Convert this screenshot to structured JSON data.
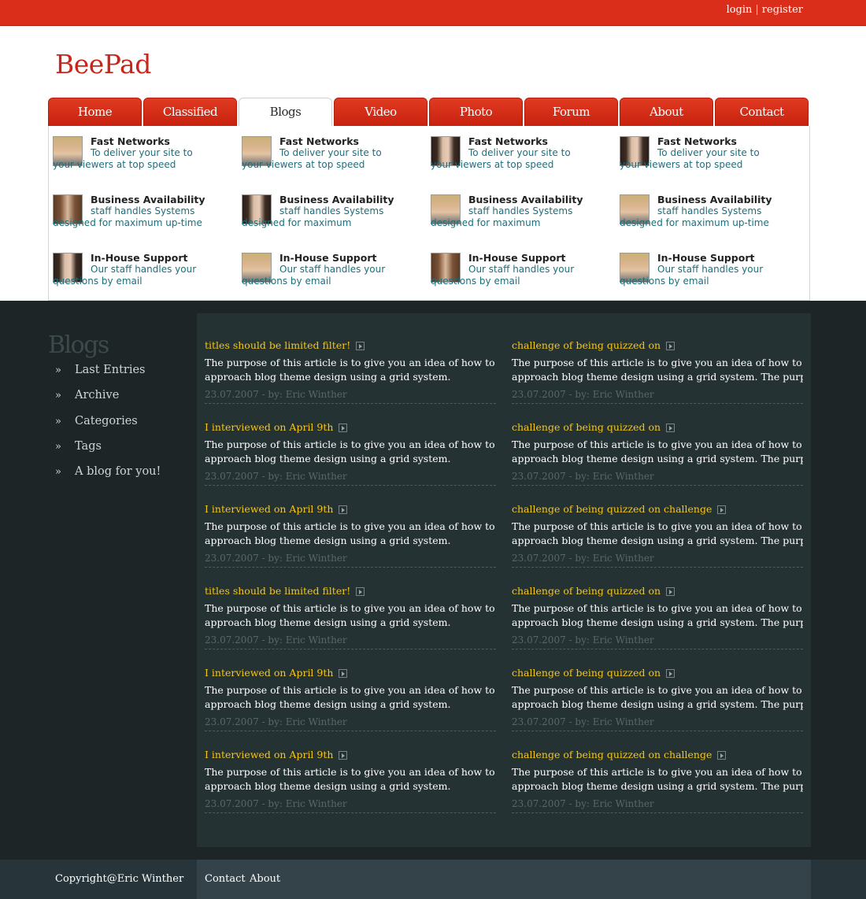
{
  "topbar": {
    "login": "login",
    "separator": "|",
    "register": "register"
  },
  "logo": "BeePad",
  "nav": [
    "Home",
    "Classified",
    "Blogs",
    "Video",
    "Photo",
    "Forum",
    "About",
    "Contact"
  ],
  "nav_active": "Blogs",
  "features": [
    {
      "title": "Fast Networks",
      "desc": "To deliver your site to your viewers at top speed",
      "avatar": "male-blond-avatar"
    },
    {
      "title": "Fast Networks",
      "desc": "To deliver your site to your viewers at top speed",
      "avatar": "male-blond-avatar"
    },
    {
      "title": "Fast Networks",
      "desc": "To deliver your site to your viewers at top speed",
      "avatar": "female-dark-hair-avatar"
    },
    {
      "title": "Fast Networks",
      "desc": "To deliver your site to your viewers at top speed",
      "avatar": "female-dark-hair-avatar"
    },
    {
      "title": "Business Availability",
      "desc": "staff handles Systems designed for maximum up-time",
      "avatar": "female-brown-hair-avatar"
    },
    {
      "title": "Business Availability",
      "desc": "staff handles Systems designed for maximum",
      "avatar": "female-dark-hair-avatar"
    },
    {
      "title": "Business Availability",
      "desc": "staff handles Systems designed for maximum",
      "avatar": "male-blond-avatar"
    },
    {
      "title": "Business Availability",
      "desc": "staff handles Systems designed for maximum up-time",
      "avatar": "male-blond-avatar"
    },
    {
      "title": "In-House Support",
      "desc": "Our staff handles your questions by email",
      "avatar": "female-dark-hair-avatar"
    },
    {
      "title": "In-House Support",
      "desc": "Our staff handles your questions by email",
      "avatar": "male-blond-avatar"
    },
    {
      "title": "In-House Support",
      "desc": "Our staff handles your questions by email",
      "avatar": "female-brown-hair-avatar"
    },
    {
      "title": "In-House Support",
      "desc": "Our staff handles your questions by email",
      "avatar": "male-blond-avatar"
    }
  ],
  "sidebar": {
    "title": "Blogs",
    "bullet": "»",
    "items": [
      "Last Entries",
      "Archive",
      "Categories",
      "Tags",
      "A blog for you!"
    ]
  },
  "posts": [
    {
      "title": "titles should be limited filter!",
      "line1": "The purpose of this article is to give you an idea of how to",
      "line2": "approach blog theme design using a grid system.",
      "meta": "23.07.2007 - by: Eric Winther"
    },
    {
      "title": "challenge of being quizzed on",
      "line1": "The purpose of this article is to give you an idea of how to",
      "line2": "approach blog theme design using a grid system. The purpose of",
      "meta": "23.07.2007 - by: Eric Winther"
    },
    {
      "title": "I interviewed on April 9th",
      "line1": "The purpose of this article is to give you an idea of how to",
      "line2": "approach blog theme design using a grid system.",
      "meta": "23.07.2007 - by: Eric Winther"
    },
    {
      "title": "challenge of being quizzed on",
      "line1": "The purpose of this article is to give you an idea of how to",
      "line2": "approach blog theme design using a grid system. The purpose of",
      "meta": "23.07.2007 - by: Eric Winther"
    },
    {
      "title": "I interviewed on April 9th",
      "line1": "The purpose of this article is to give you an idea of how to",
      "line2": "approach blog theme design using a grid system.",
      "meta": "23.07.2007 - by: Eric Winther"
    },
    {
      "title": "challenge of being quizzed on challenge",
      "line1": "The purpose of this article is to give you an idea of how to",
      "line2": "approach blog theme design using a grid system. The purpose of",
      "meta": "23.07.2007 - by: Eric Winther"
    },
    {
      "title": "titles should be limited filter!",
      "line1": "The purpose of this article is to give you an idea of how to",
      "line2": "approach blog theme design using a grid system.",
      "meta": "23.07.2007 - by: Eric Winther"
    },
    {
      "title": "challenge of being quizzed on",
      "line1": "The purpose of this article is to give you an idea of how to",
      "line2": "approach blog theme design using a grid system. The purpose of",
      "meta": "23.07.2007 - by: Eric Winther"
    },
    {
      "title": "I interviewed on April 9th",
      "line1": "The purpose of this article is to give you an idea of how to",
      "line2": "approach blog theme design using a grid system.",
      "meta": "23.07.2007 - by: Eric Winther"
    },
    {
      "title": "challenge of being quizzed on",
      "line1": "The purpose of this article is to give you an idea of how to",
      "line2": "approach blog theme design using a grid system. The purpose of",
      "meta": "23.07.2007 - by: Eric Winther"
    },
    {
      "title": "I interviewed on April 9th",
      "line1": "The purpose of this article is to give you an idea of how to",
      "line2": "approach blog theme design using a grid system.",
      "meta": "23.07.2007 - by: Eric Winther"
    },
    {
      "title": "challenge of being quizzed on challenge",
      "line1": "The purpose of this article is to give you an idea of how to",
      "line2": "approach blog theme design using a grid system. The purpose of",
      "meta": "23.07.2007 - by: Eric Winther"
    }
  ],
  "footer": {
    "copyright": "Copyright@Eric Winther",
    "links": [
      "Contact",
      "About"
    ]
  },
  "colors": {
    "brand_red": "#db2e1a",
    "post_title": "#f5c518",
    "feature_desc": "#1d6e7b",
    "dark_bg": "#1d2527",
    "panel_bg": "#253234"
  }
}
